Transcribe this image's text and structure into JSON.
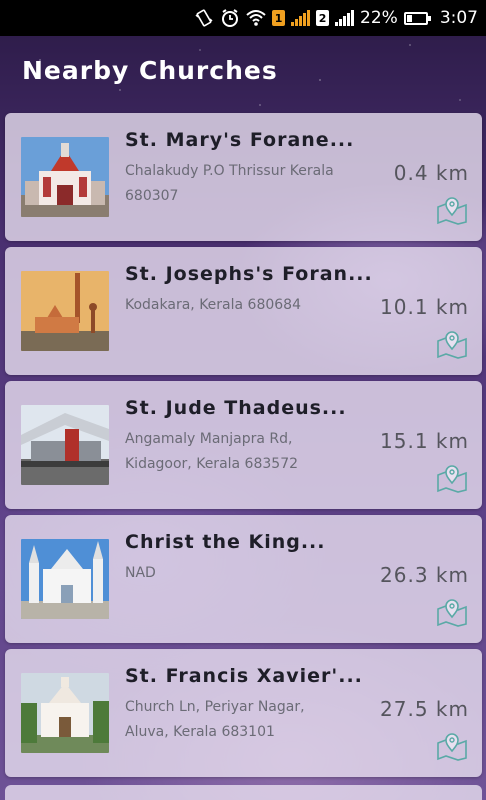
{
  "status": {
    "sim1": "1",
    "sim2": "2",
    "battery": "22%",
    "time": "3:07"
  },
  "header": {
    "title": "Nearby Churches"
  },
  "colors": {
    "accent_pin": "#5aa9a6",
    "card_bg": "#e8e0f0"
  },
  "churches": [
    {
      "name": "St. Mary's Forane...",
      "address_line1": "Chalakudy P.O Thrissur Kerala",
      "address_line2": "680307",
      "distance": "0.4 km"
    },
    {
      "name": "St. Josephs's Foran...",
      "address_line1": "Kodakara, Kerala 680684",
      "address_line2": "",
      "distance": "10.1 km"
    },
    {
      "name": "St. Jude Thadeus...",
      "address_line1": "Angamaly Manjapra Rd,",
      "address_line2": "Kidagoor, Kerala 683572",
      "distance": "15.1 km"
    },
    {
      "name": "Christ the King...",
      "address_line1": "NAD",
      "address_line2": "",
      "distance": "26.3 km"
    },
    {
      "name": "St. Francis Xavier'...",
      "address_line1": "Church Ln, Periyar Nagar,",
      "address_line2": "Aluva, Kerala 683101",
      "distance": "27.5 km"
    }
  ]
}
